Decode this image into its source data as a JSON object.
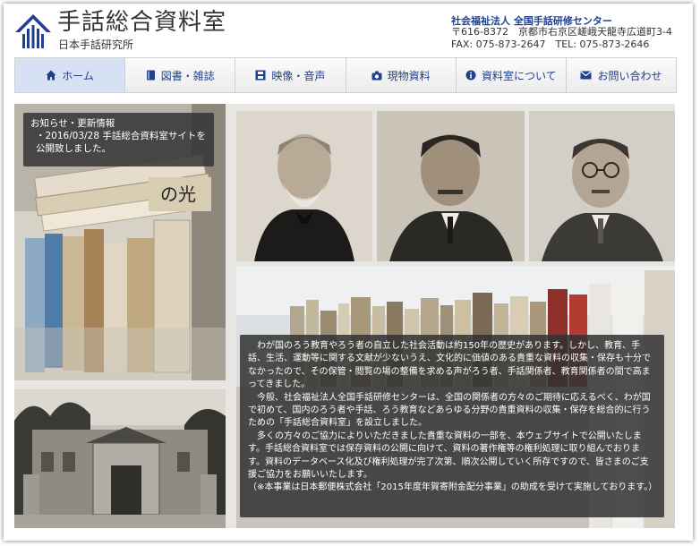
{
  "header": {
    "site_title": "手話総合資料室",
    "site_subtitle": "日本手話研究所",
    "org_name": "社会福祉法人 全国手話研修センター",
    "address": "〒616-8372　京都市右京区嵯峨天龍寺広道町3-4",
    "contact": "FAX: 075-873-2647　TEL: 075-873-2646"
  },
  "nav": {
    "items": [
      {
        "label": "ホーム",
        "icon": "home-icon"
      },
      {
        "label": "図書・雑誌",
        "icon": "book-icon"
      },
      {
        "label": "映像・音声",
        "icon": "film-icon"
      },
      {
        "label": "現物資料",
        "icon": "camera-icon"
      },
      {
        "label": "資料室について",
        "icon": "info-icon"
      },
      {
        "label": "お問い合わせ",
        "icon": "envelope-icon"
      }
    ]
  },
  "notice": {
    "heading": "お知らせ・更新情報",
    "item": "・2016/03/28 手話総合資料室サイトを公開致しました。"
  },
  "book_spine_text": "の光",
  "about": {
    "p1": "わが国のろう教育やろう者の自立した社会活動は約150年の歴史があります。しかし、教育、手話、生活、運動等に関する文献が少ないうえ、文化的に価値のある貴重な資料の収集・保存も十分でなかったので、その保管・閲覧の場の整備を求める声がろう者、手話関係者、教育関係者の間で高まってきました。",
    "p2": "今般、社会福祉法人全国手話研修センターは、全国の関係者の方々のご期待に応えるべく、わが国で初めて、国内のろう者や手話、ろう教育などあらゆる分野の貴重資料の収集・保存を総合的に行うための「手話総合資料室」を設立しました。",
    "p3": "多くの方々のご協力によりいただきました貴重な資料の一部を、本ウェブサイトで公開いたします。手話総合資料室では保存資料の公開に向けて、資料の著作権等の権利処理に取り組んでおります。資料のデータベース化及び権利処理が完了次第、順次公開していく所存ですので、皆さまのご支援ご協力をお願いいたします。",
    "p4": "（※本事業は日本郵便株式会社「2015年度年賀寄附金配分事業」の助成を受けて実施しております。）"
  },
  "colors": {
    "accent": "#1f3f8f",
    "nav_active": "#d6e2f4",
    "overlay": "#323232"
  }
}
